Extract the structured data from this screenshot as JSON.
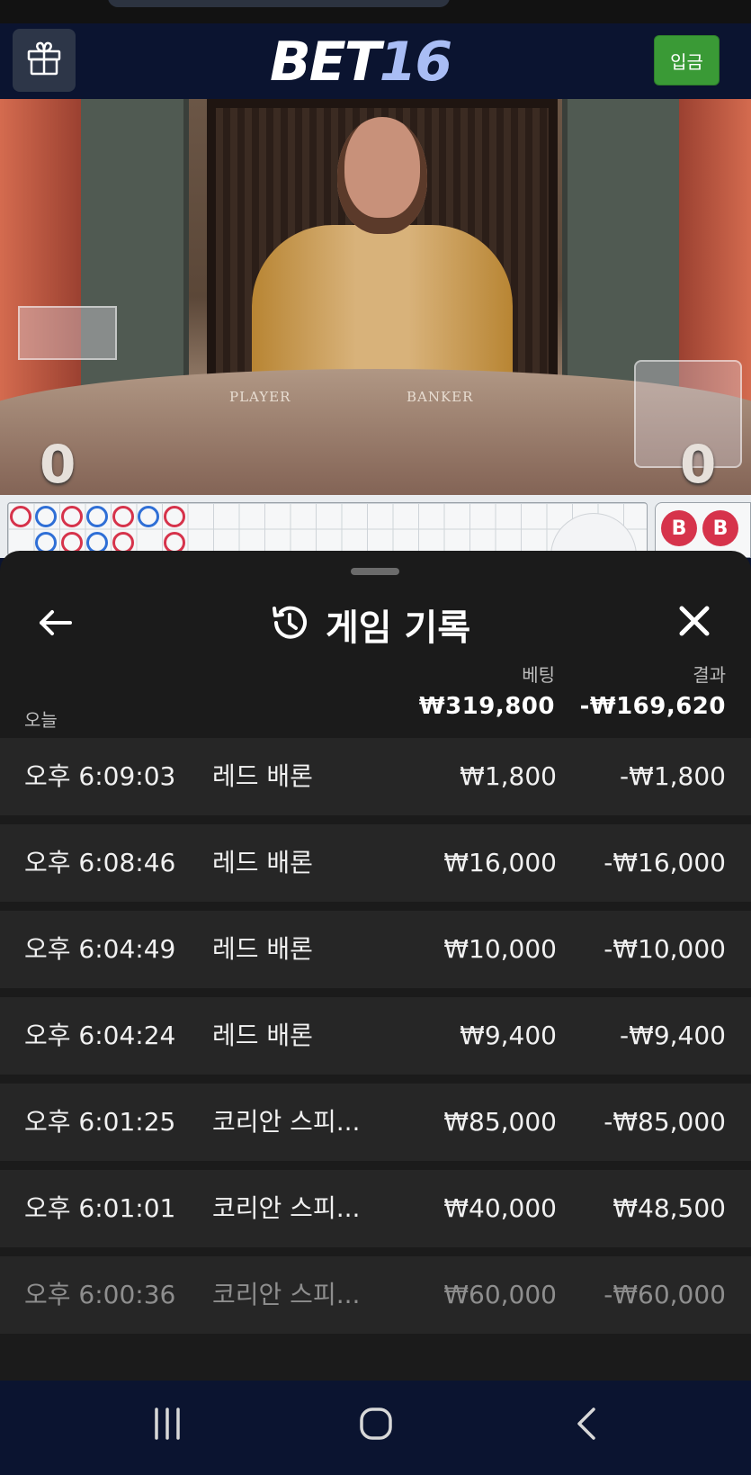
{
  "header": {
    "logo_bet": "BET",
    "logo_num": "16",
    "deposit_label": "입금"
  },
  "video": {
    "player_label": "PLAYER",
    "banker_label": "BANKER",
    "player_score": "0",
    "banker_score": "0"
  },
  "roadmap": {
    "bead_labels": [
      "B",
      "B"
    ]
  },
  "history": {
    "title": "게임 기록",
    "summary": {
      "today_label": "오늘",
      "bet_label": "베팅",
      "result_label": "결과",
      "bet_total": "₩319,800",
      "result_total": "-₩169,620"
    },
    "rows": [
      {
        "time": "오후 6:09:03",
        "game": "레드 배론",
        "bet": "₩1,800",
        "result": "-₩1,800"
      },
      {
        "time": "오후 6:08:46",
        "game": "레드 배론",
        "bet": "₩16,000",
        "result": "-₩16,000"
      },
      {
        "time": "오후 6:04:49",
        "game": "레드 배론",
        "bet": "₩10,000",
        "result": "-₩10,000"
      },
      {
        "time": "오후 6:04:24",
        "game": "레드 배론",
        "bet": "₩9,400",
        "result": "-₩9,400"
      },
      {
        "time": "오후 6:01:25",
        "game": "코리안 스피...",
        "bet": "₩85,000",
        "result": "-₩85,000"
      },
      {
        "time": "오후 6:01:01",
        "game": "코리안 스피...",
        "bet": "₩40,000",
        "result": "₩48,500"
      },
      {
        "time": "오후 6:00:36",
        "game": "코리안 스피...",
        "bet": "₩60,000",
        "result": "-₩60,000"
      }
    ]
  },
  "icons": {
    "gift": "gift-icon",
    "back": "arrow-left-icon",
    "history": "history-icon",
    "close": "close-icon",
    "nav_recents": "recents-icon",
    "nav_home": "home-icon",
    "nav_back": "chevron-left-icon"
  },
  "colors": {
    "deposit_green": "#3a9a36",
    "logo_accent": "#a9bdf5",
    "sheet_bg": "#1b1b1b",
    "row_bg": "#262626",
    "banker_red": "#d6334b",
    "player_blue": "#2f6fd6"
  }
}
